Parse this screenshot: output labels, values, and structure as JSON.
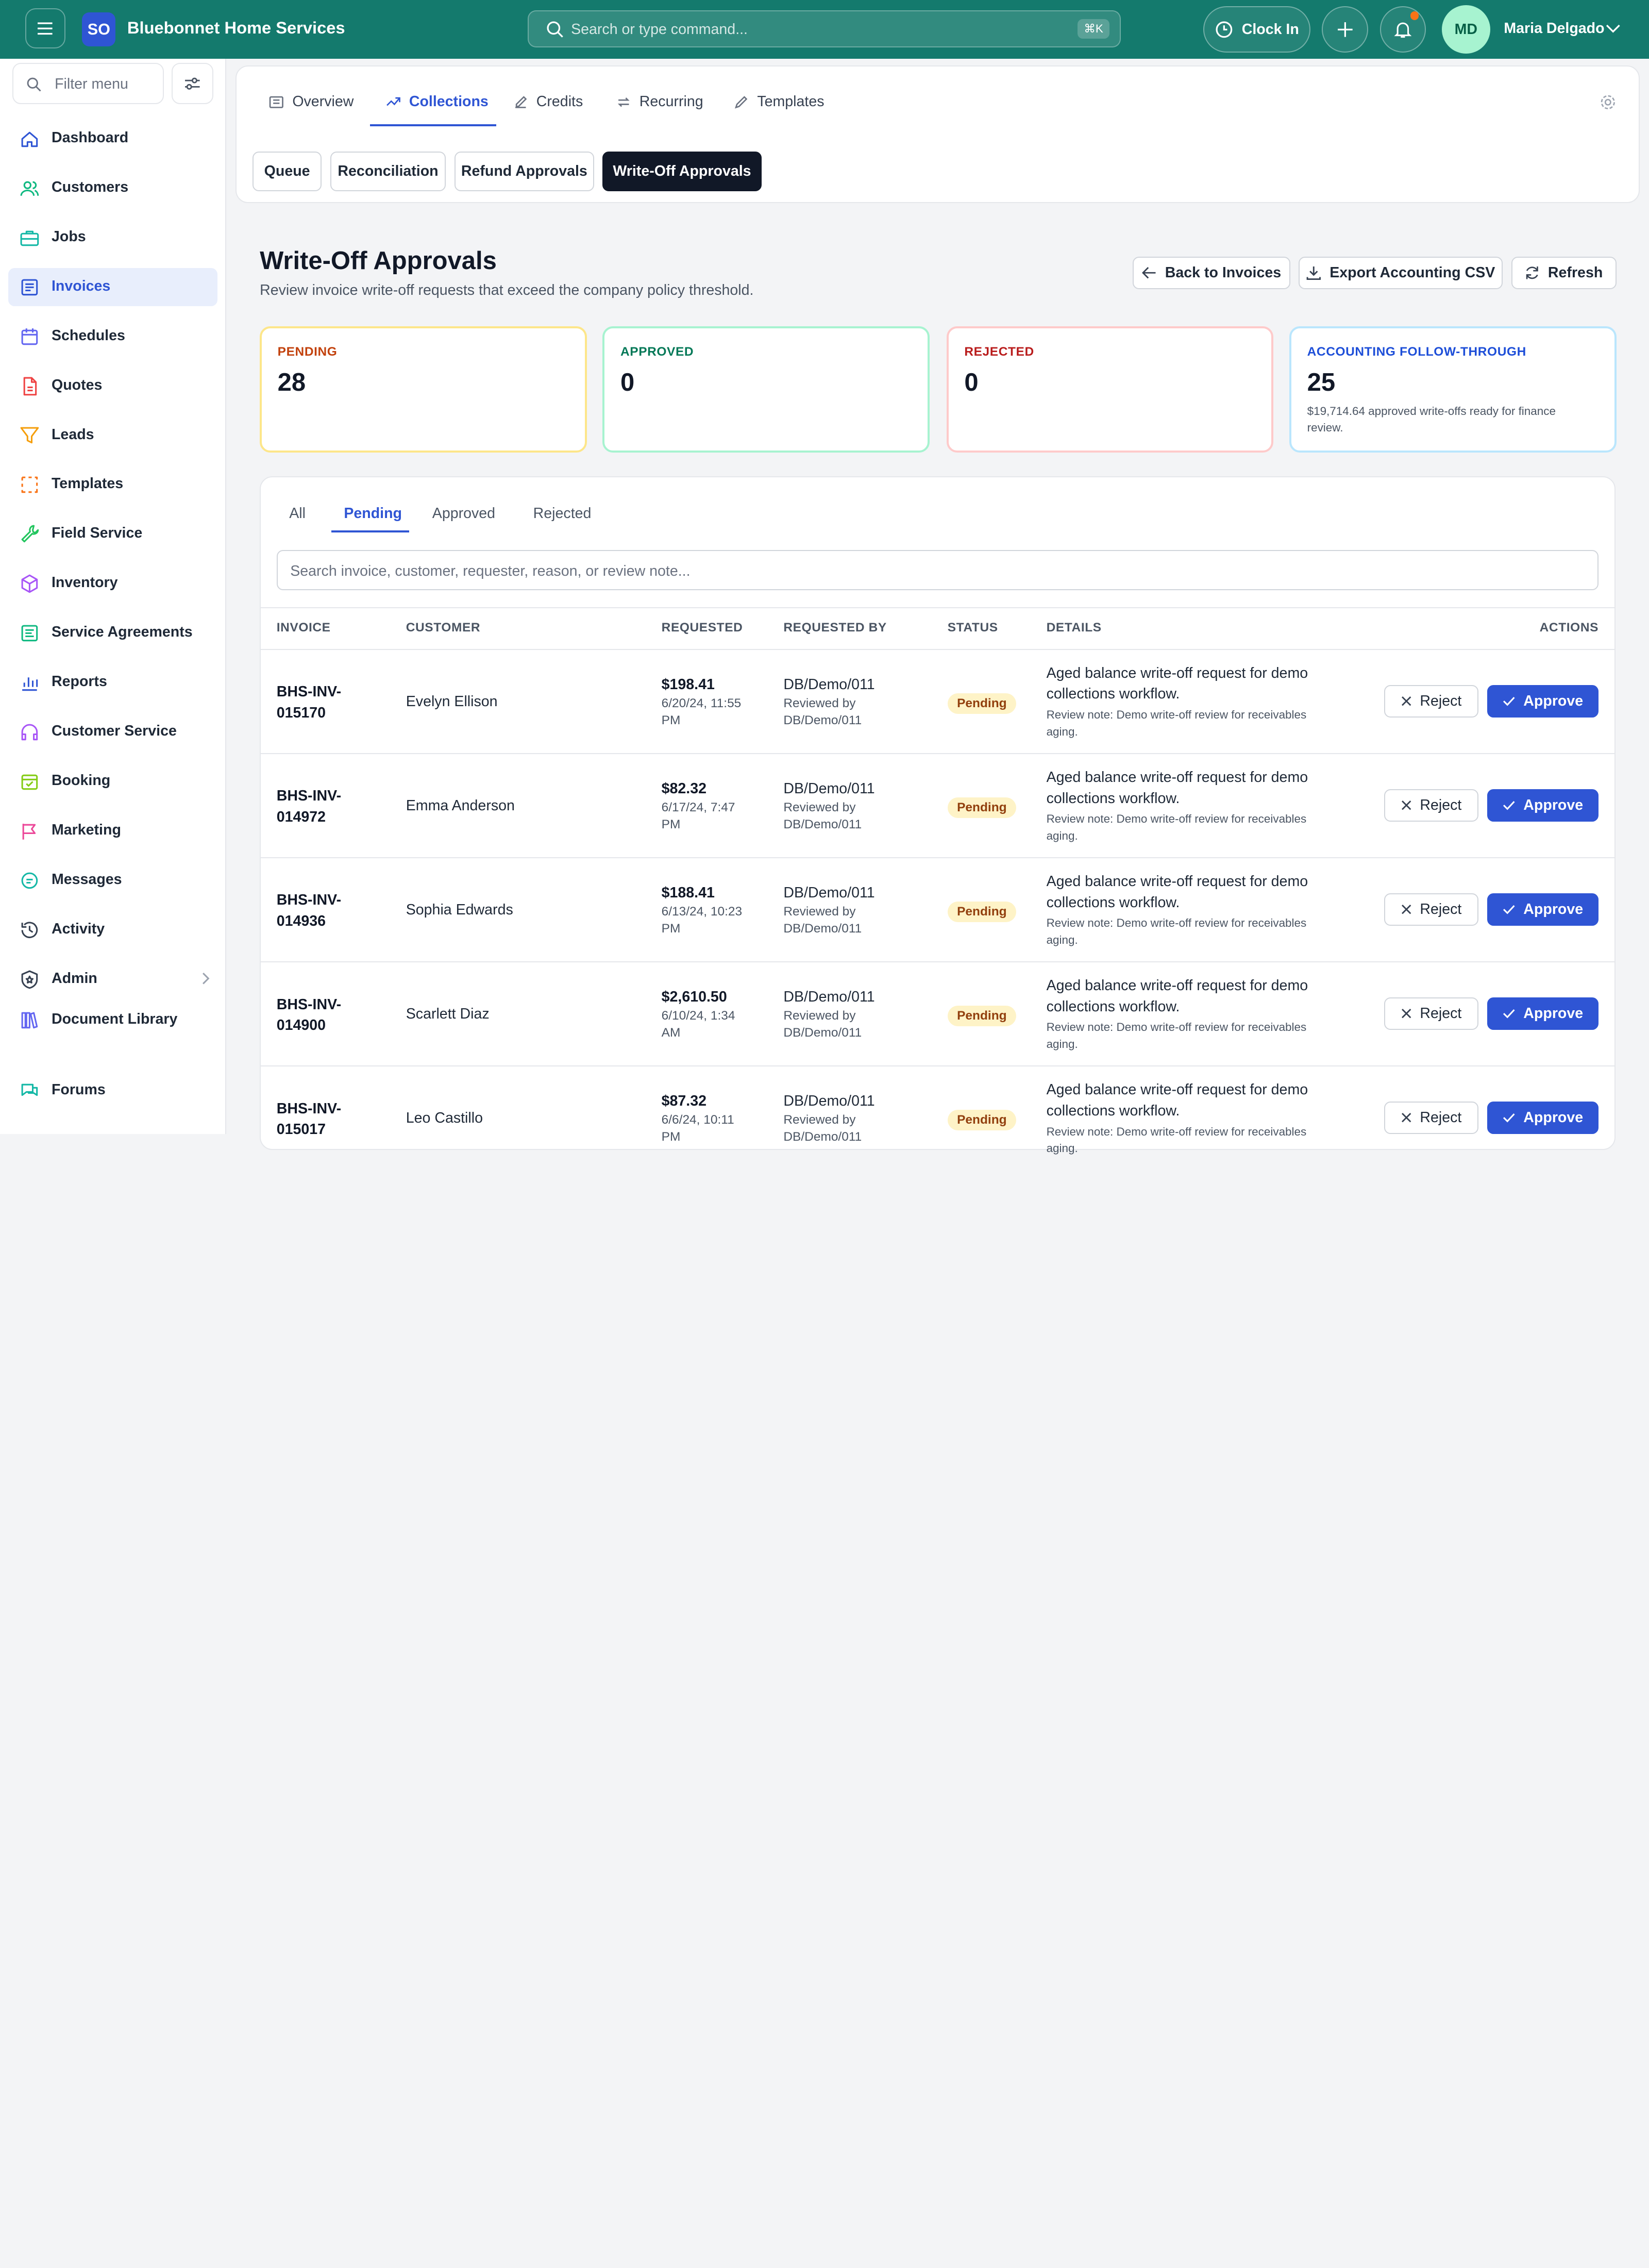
{
  "header": {
    "logo_text": "SO",
    "brand": "Bluebonnet Home Services",
    "search_placeholder": "Search or type command...",
    "shortcut": "⌘K",
    "clock_in": "Clock In",
    "user_initials": "MD",
    "user_name": "Maria Delgado"
  },
  "sidebar": {
    "filter_placeholder": "Filter menu",
    "items": [
      {
        "label": "Dashboard",
        "icon": "home-icon",
        "color": "#2f55d4"
      },
      {
        "label": "Customers",
        "icon": "users-icon",
        "color": "#10b981"
      },
      {
        "label": "Jobs",
        "icon": "briefcase-icon",
        "color": "#14b8a6"
      },
      {
        "label": "Invoices",
        "icon": "invoice-icon",
        "color": "#2f55d4"
      },
      {
        "label": "Schedules",
        "icon": "calendar-icon",
        "color": "#6366f1"
      },
      {
        "label": "Quotes",
        "icon": "file-icon",
        "color": "#ef4444"
      },
      {
        "label": "Leads",
        "icon": "funnel-icon",
        "color": "#f59e0b"
      },
      {
        "label": "Templates",
        "icon": "template-icon",
        "color": "#f97316"
      },
      {
        "label": "Field Service",
        "icon": "wrench-icon",
        "color": "#22c55e"
      },
      {
        "label": "Inventory",
        "icon": "box-icon",
        "color": "#a855f7"
      },
      {
        "label": "Service Agreements",
        "icon": "agreement-icon",
        "color": "#10b981"
      },
      {
        "label": "Reports",
        "icon": "chart-icon",
        "color": "#2f55d4"
      },
      {
        "label": "Customer Service",
        "icon": "headset-icon",
        "color": "#a855f7"
      },
      {
        "label": "Booking",
        "icon": "booking-icon",
        "color": "#84cc16"
      },
      {
        "label": "Marketing",
        "icon": "flag-icon",
        "color": "#ec4899"
      },
      {
        "label": "Messages",
        "icon": "message-icon",
        "color": "#14b8a6"
      },
      {
        "label": "Activity",
        "icon": "history-icon",
        "color": "#374151"
      },
      {
        "label": "Admin",
        "icon": "shield-icon",
        "color": "#374151"
      },
      {
        "label": "Document Library",
        "icon": "library-icon",
        "color": "#6366f1"
      },
      {
        "label": "Forums",
        "icon": "forum-icon",
        "color": "#14b8a6"
      }
    ]
  },
  "tabs": [
    "Overview",
    "Collections",
    "Credits",
    "Recurring",
    "Templates"
  ],
  "subtabs": [
    "Queue",
    "Reconciliation",
    "Refund Approvals",
    "Write-Off Approvals"
  ],
  "page": {
    "title": "Write-Off Approvals",
    "subtitle": "Review invoice write-off requests that exceed the company policy threshold.",
    "back_btn": "Back to Invoices",
    "export_btn": "Export Accounting CSV",
    "refresh_btn": "Refresh"
  },
  "stats": [
    {
      "label": "PENDING",
      "value": "28",
      "desc": "",
      "color": "#c2410c",
      "border": "#fde68a"
    },
    {
      "label": "APPROVED",
      "value": "0",
      "desc": "",
      "color": "#047857",
      "border": "#a7f3d0"
    },
    {
      "label": "REJECTED",
      "value": "0",
      "desc": "",
      "color": "#b91c1c",
      "border": "#fecaca"
    },
    {
      "label": "ACCOUNTING FOLLOW-THROUGH",
      "value": "25",
      "desc": "$19,714.64 approved write-offs ready for finance review.",
      "color": "#1d4ed8",
      "border": "#bae6fd"
    }
  ],
  "filter_tabs": [
    "All",
    "Pending",
    "Approved",
    "Rejected"
  ],
  "table": {
    "search_placeholder": "Search invoice, customer, requester, reason, or review note...",
    "headers": [
      "INVOICE",
      "CUSTOMER",
      "REQUESTED",
      "REQUESTED BY",
      "STATUS",
      "DETAILS",
      "ACTIONS"
    ],
    "reject_label": "Reject",
    "approve_label": "Approve",
    "rows": [
      {
        "invoice": "BHS-INV-015170",
        "customer": "Evelyn Ellison",
        "amount": "$198.41",
        "date": "6/20/24, 11:55 PM",
        "by": "DB/Demo/011",
        "reviewed": "Reviewed by DB/Demo/011",
        "status": "Pending",
        "details": "Aged balance write-off request for demo collections workflow.",
        "note": "Review note: Demo write-off review for receivables aging."
      },
      {
        "invoice": "BHS-INV-014972",
        "customer": "Emma Anderson",
        "amount": "$82.32",
        "date": "6/17/24, 7:47 PM",
        "by": "DB/Demo/011",
        "reviewed": "Reviewed by DB/Demo/011",
        "status": "Pending",
        "details": "Aged balance write-off request for demo collections workflow.",
        "note": "Review note: Demo write-off review for receivables aging."
      },
      {
        "invoice": "BHS-INV-014936",
        "customer": "Sophia Edwards",
        "amount": "$188.41",
        "date": "6/13/24, 10:23 PM",
        "by": "DB/Demo/011",
        "reviewed": "Reviewed by DB/Demo/011",
        "status": "Pending",
        "details": "Aged balance write-off request for demo collections workflow.",
        "note": "Review note: Demo write-off review for receivables aging."
      },
      {
        "invoice": "BHS-INV-014900",
        "customer": "Scarlett Diaz",
        "amount": "$2,610.50",
        "date": "6/10/24, 1:34 AM",
        "by": "DB/Demo/011",
        "reviewed": "Reviewed by DB/Demo/011",
        "status": "Pending",
        "details": "Aged balance write-off request for demo collections workflow.",
        "note": "Review note: Demo write-off review for receivables aging."
      },
      {
        "invoice": "BHS-INV-015017",
        "customer": "Leo Castillo",
        "amount": "$87.32",
        "date": "6/6/24, 10:11 PM",
        "by": "DB/Demo/011",
        "reviewed": "Reviewed by DB/Demo/011",
        "status": "Pending",
        "details": "Aged balance write-off request for demo collections workflow.",
        "note": "Review note: Demo write-off review for receivables aging."
      }
    ]
  }
}
